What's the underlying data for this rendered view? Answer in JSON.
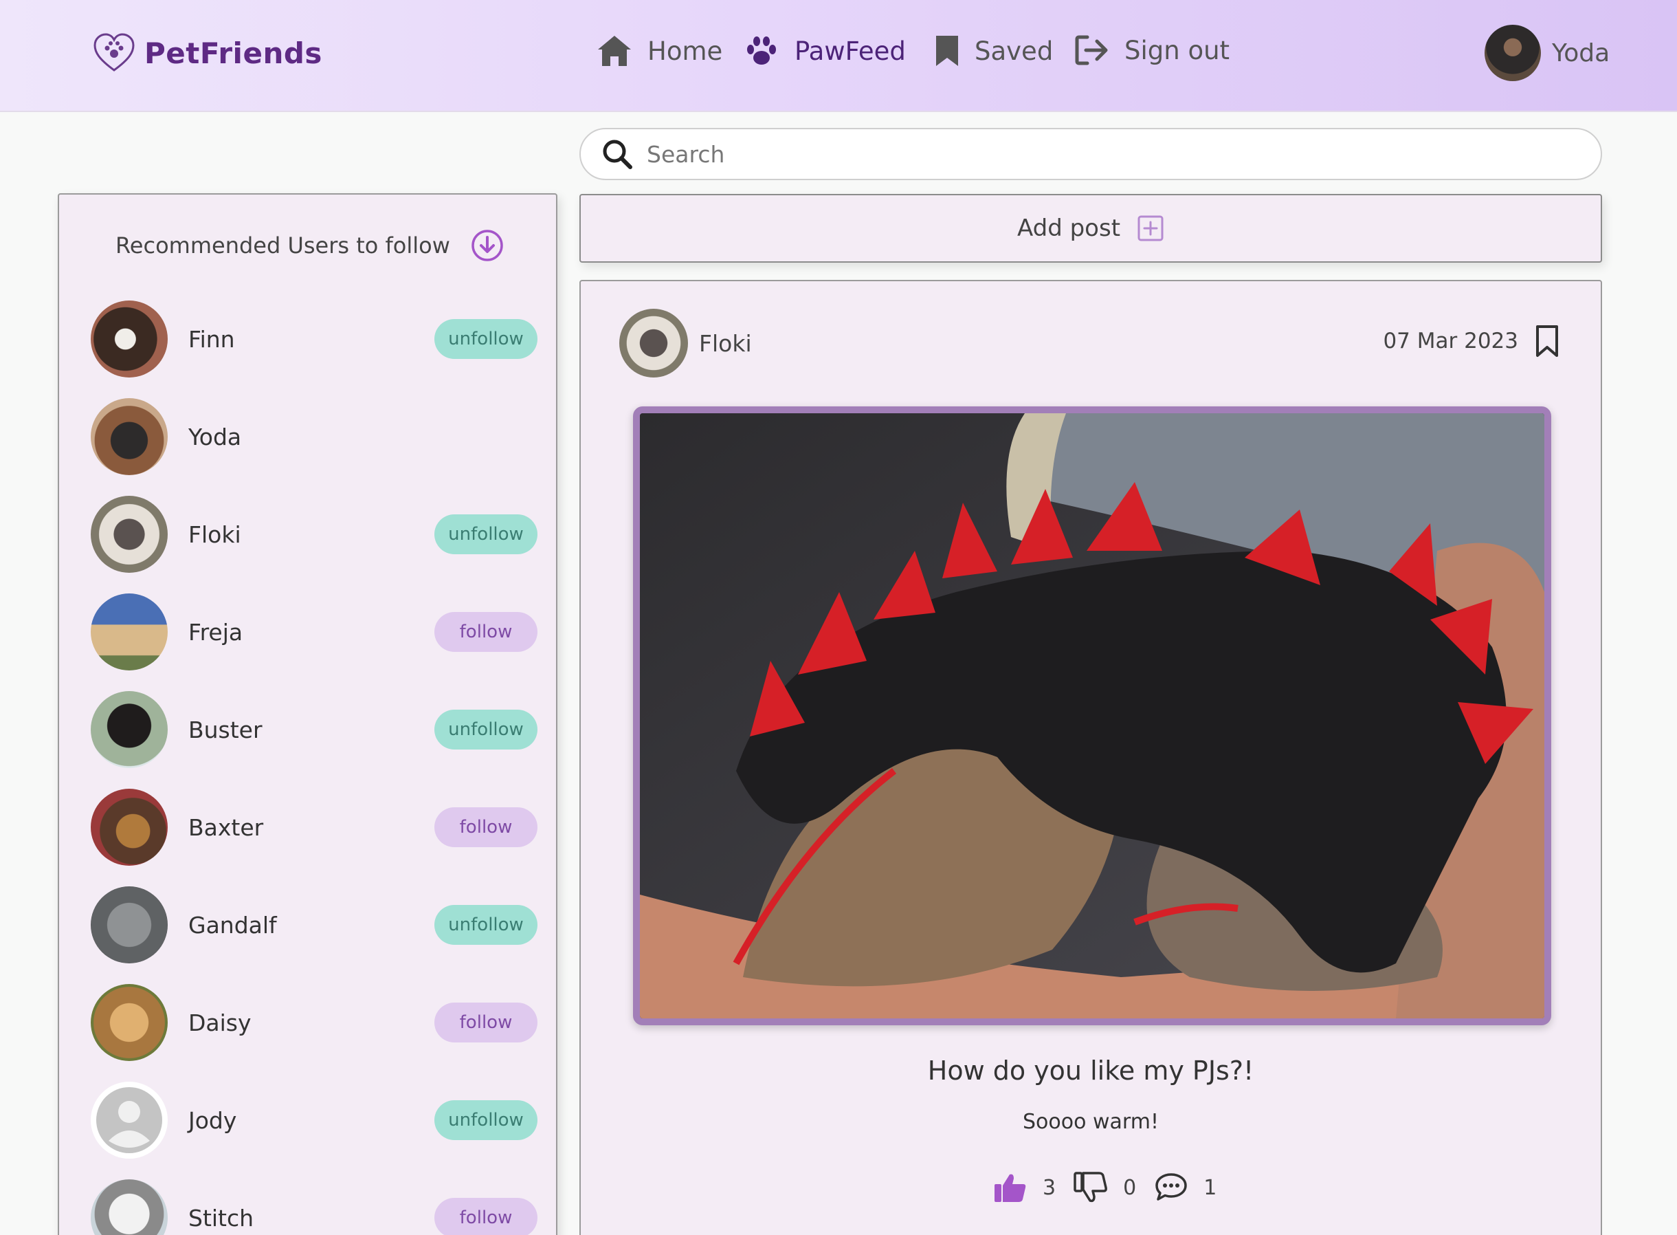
{
  "brand": {
    "name": "PetFriends"
  },
  "nav": {
    "home": "Home",
    "pawfeed": "PawFeed",
    "saved": "Saved",
    "signout": "Sign out",
    "user": "Yoda"
  },
  "search": {
    "placeholder": "Search"
  },
  "sidebar": {
    "title": "Recommended Users to follow",
    "users": [
      {
        "name": "Finn",
        "action": "unfollow"
      },
      {
        "name": "Yoda",
        "action": ""
      },
      {
        "name": "Floki",
        "action": "unfollow"
      },
      {
        "name": "Freja",
        "action": "follow"
      },
      {
        "name": "Buster",
        "action": "unfollow"
      },
      {
        "name": "Baxter",
        "action": "follow"
      },
      {
        "name": "Gandalf",
        "action": "unfollow"
      },
      {
        "name": "Daisy",
        "action": "follow"
      },
      {
        "name": "Jody",
        "action": "unfollow"
      },
      {
        "name": "Stitch",
        "action": "follow"
      }
    ]
  },
  "add_post": {
    "label": "Add post"
  },
  "post": {
    "author": "Floki",
    "date": "07 Mar 2023",
    "title": "How do you like my PJs?!",
    "body": "Soooo warm!",
    "likes": "3",
    "dislikes": "0",
    "comments": "1"
  },
  "colors": {
    "brand": "#5e2a84",
    "unfollow_bg": "#9fe0d4",
    "follow_bg": "#dfc9ee",
    "accent": "#a455c9"
  }
}
